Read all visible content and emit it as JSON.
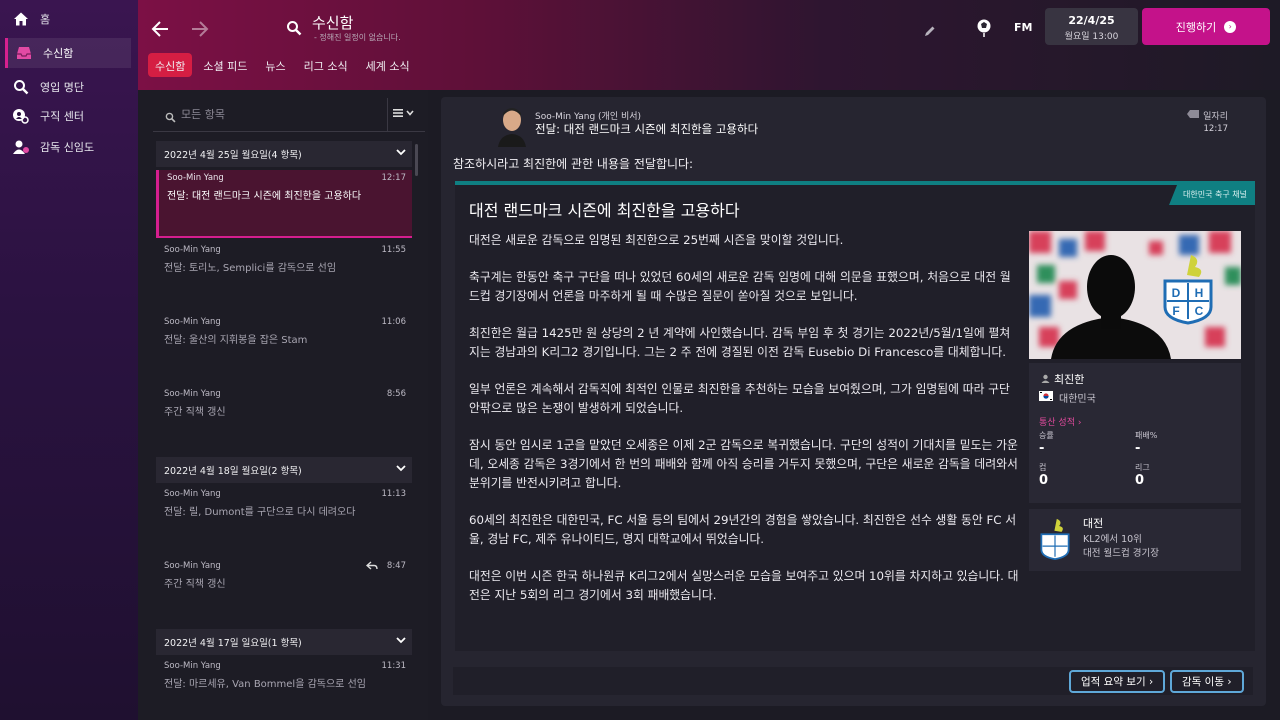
{
  "nav": {
    "items": [
      {
        "label": "홈",
        "icon": "home-icon"
      },
      {
        "label": "수신함",
        "icon": "inbox-icon"
      },
      {
        "label": "영입 명단",
        "icon": "search-icon"
      },
      {
        "label": "구직 센터",
        "icon": "job-centre-icon"
      },
      {
        "label": "감독 신임도",
        "icon": "manager-confidence-icon"
      }
    ]
  },
  "header": {
    "title": "수신함",
    "subtitle": "- 정해진 일정이 없습니다.",
    "fm_label": "FM",
    "date": "22/4/25",
    "time": "월요일 13:00",
    "continue_label": "진행하기"
  },
  "tabs": [
    "수신함",
    "소셜 피드",
    "뉴스",
    "리그 소식",
    "세계 소식"
  ],
  "list": {
    "search_placeholder": "모든 항목",
    "groups": [
      {
        "label": "2022년 4월 25일 월요일(4 항목)"
      },
      {
        "label": "2022년 4월 18일 월요일(2 항목)"
      },
      {
        "label": "2022년 4월 17일 일요일(1 항목)"
      }
    ],
    "messages": [
      {
        "from": "Soo-Min Yang",
        "time": "12:17",
        "subject": "전달: 대전 랜드마크 시즌에 최진한을 고용하다"
      },
      {
        "from": "Soo-Min Yang",
        "time": "11:55",
        "subject": "전달: 토리노, Semplici를 감독으로 선임"
      },
      {
        "from": "Soo-Min Yang",
        "time": "11:06",
        "subject": "전달: 울산의 지휘봉을 잡은 Stam"
      },
      {
        "from": "Soo-Min Yang",
        "time": "8:56",
        "subject": "주간 직책 갱신"
      },
      {
        "from": "Soo-Min Yang",
        "time": "11:13",
        "subject": "전달: 릴, Dumont를 구단으로 다시 데려오다"
      },
      {
        "from": "Soo-Min Yang",
        "time": "8:47",
        "subject": "주간 직책 갱신"
      },
      {
        "from": "Soo-Min Yang",
        "time": "11:31",
        "subject": "전달: 마르세유, Van Bommel을 감독으로 선임"
      }
    ]
  },
  "detail": {
    "sender_name": "Soo-Min Yang",
    "sender_role": "(개인 비서)",
    "subject": "전달: 대전 랜드마크 시즌에 최진한을 고용하다",
    "away_label": "일자리",
    "time": "12:17",
    "intro": "참조하시라고 최진한에 관한 내용을 전달합니다:",
    "article_tag": "대한민국 축구 채널",
    "article_title": "대전 랜드마크 시즌에 최진한을 고용하다",
    "paragraphs": [
      "대전은 새로운 감독으로 임명된 최진한으로 25번째 시즌을 맞이할 것입니다.",
      "축구계는 한동안 축구 구단을 떠나 있었던 60세의 새로운 감독 임명에 대해 의문을 표했으며, 처음으로 대전 월드컵 경기장에서 언론을 마주하게 될 때 수많은 질문이 쏟아질 것으로 보입니다.",
      "최진한은 월급 1425만 원 상당의 2 년 계약에 사인했습니다. 감독 부임 후 첫 경기는 2022년/5월/1일에 펼쳐지는 경남과의 K리그2 경기입니다. 그는 2 주 전에 경질된 이전 감독 Eusebio Di Francesco를 대체합니다.",
      "일부 언론은 계속해서 감독직에 최적인 인물로 최진한을 추천하는 모습을 보여줬으며, 그가 임명됨에 따라 구단 안팎으로 많은 논쟁이 발생하게 되었습니다.",
      "잠시 동안 임시로 1군을 맡았던 오세종은 이제 2군 감독으로 복귀했습니다. 구단의 성적이 기대치를 밑도는 가운데, 오세종 감독은 3경기에서 한 번의 패배와 함께 아직 승리를 거두지 못했으며, 구단은 새로운 감독을 데려와서 분위기를 반전시키려고 합니다.",
      "60세의 최진한은 대한민국, FC 서울 등의 팀에서 29년간의 경험을 쌓았습니다. 최진한은 선수 생활 동안 FC 서울, 경남 FC, 제주 유나이티드, 명지 대학교에서 뛰었습니다.",
      "대전은 이번 시즌 한국 하나원큐 K리그2에서 실망스러운 모습을 보여주고 있으며 10위를 차지하고 있습니다. 대전은 지난 5회의 리그 경기에서 3회 패배했습니다."
    ],
    "person": {
      "name": "최진한",
      "nation": "대한민국",
      "stats_link": "통산 성적",
      "stats": [
        {
          "label": "승률",
          "value": "-"
        },
        {
          "label": "패배%",
          "value": "-"
        },
        {
          "label": "컵",
          "value": "0"
        },
        {
          "label": "리그",
          "value": "0"
        }
      ]
    },
    "club": {
      "name": "대전",
      "league_pos": "KL2에서 10위",
      "stadium": "대전 월드컵 경기장",
      "crest_letters": [
        "D",
        "H",
        "F",
        "C"
      ]
    },
    "buttons": {
      "summary": "업적 요약 보기",
      "go_manager": "감독 이동"
    }
  },
  "colors": {
    "accent": "#c4128a",
    "tab_active": "#d51e43",
    "article_tag": "#0f7f82"
  }
}
